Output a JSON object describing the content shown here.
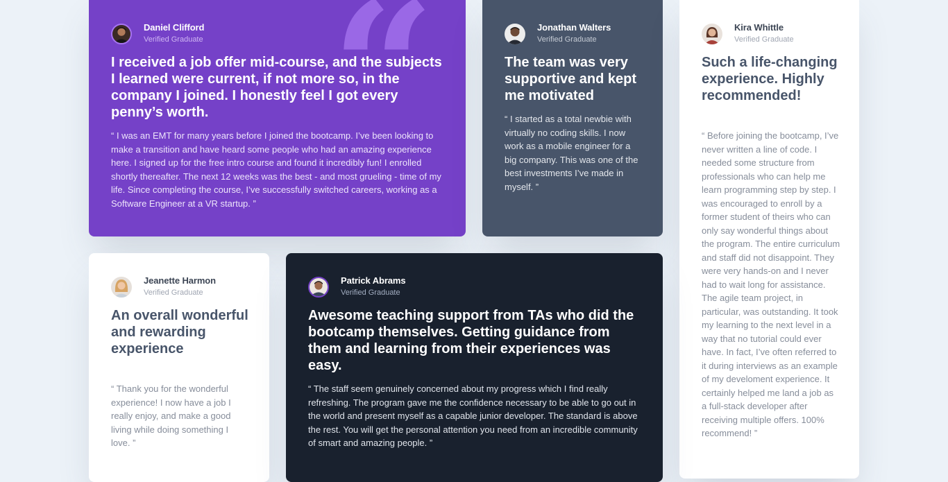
{
  "colors": {
    "page_background": "#ECF2F8",
    "moderate_violet": "#7541C8",
    "grayish_blue": "#48556A",
    "very_dark_blackish_blue": "#19212E",
    "white": "#FFFFFF",
    "quote_accent": "#A775F1"
  },
  "testimonials": {
    "daniel": {
      "avatar_icon": "avatar-daniel-icon",
      "name": "Daniel Clifford",
      "role": "Verified Graduate",
      "headline": "I received a job offer mid-course, and the subjects I learned were current, if not more so, in the company I joined. I honestly feel I got every penny’s worth.",
      "body": "“ I was an EMT for many years before I joined the bootcamp. I’ve been looking to make a transition and have heard some people who had an amazing experience here. I signed up for the free intro course and found it incredibly fun! I enrolled shortly thereafter. The next 12 weeks was the best - and most grueling - time of my life. Since completing the course, I’ve successfully switched careers, working as a Software Engineer at a VR startup. ”"
    },
    "jonathan": {
      "avatar_icon": "avatar-jonathan-icon",
      "name": "Jonathan Walters",
      "role": "Verified Graduate",
      "headline": "The team was very supportive and kept me motivated",
      "body": "“ I started as a total newbie with virtually no coding skills. I now work as a mobile engineer for a big company. This was one of the best investments I’ve made in myself. ”"
    },
    "kira": {
      "avatar_icon": "avatar-kira-icon",
      "name": "Kira Whittle",
      "role": "Verified Graduate",
      "headline": "Such a life-changing experience. Highly recommended!",
      "body": "“ Before joining the bootcamp, I’ve never written a line of code. I needed some structure from professionals who can help me learn programming step by step. I was encouraged to enroll by a former student of theirs who can only say wonderful things about the program. The entire curriculum and staff did not disappoint. They were very hands-on and I never had to wait long for assistance. The agile team project, in particular, was outstanding. It took my learning to the next level in a way that no tutorial could ever have. In fact, I’ve often referred to it during interviews as an example of my develoment experience. It certainly helped me land a job as a full-stack developer after receiving multiple offers. 100% recommend! ”"
    },
    "jeanette": {
      "avatar_icon": "avatar-jeanette-icon",
      "name": "Jeanette Harmon",
      "role": "Verified Graduate",
      "headline": "An overall wonderful and rewarding experience",
      "body": "“ Thank you for the wonderful experience! I now have a job I really enjoy, and make a good living while doing something I love. ”"
    },
    "patrick": {
      "avatar_icon": "avatar-patrick-icon",
      "name": "Patrick Abrams",
      "role": "Verified Graduate",
      "headline": "Awesome teaching support from TAs who did the bootcamp themselves. Getting guidance from them and learning from their experiences was easy.",
      "body": "“ The staff seem genuinely concerned about my progress which I find really refreshing. The program gave me the confidence necessary to be able to go out in the world and present myself as a capable junior developer. The standard is above the rest. You will get the personal attention you need from an incredible community of smart and amazing people. ”"
    }
  },
  "decoration": {
    "quote_icon": "quote-mark-icon"
  }
}
